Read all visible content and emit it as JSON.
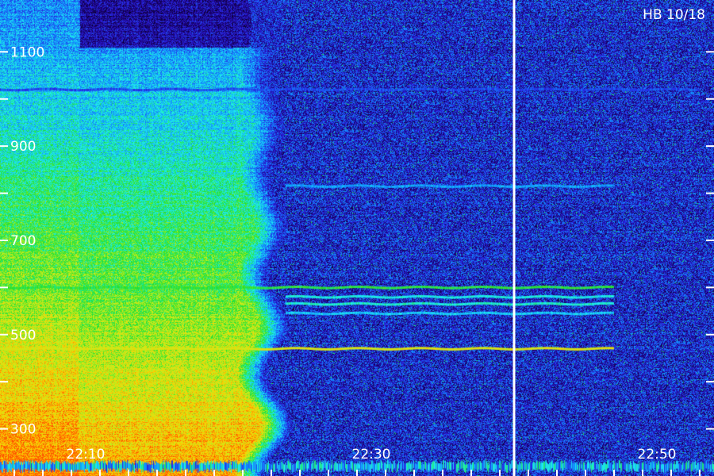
{
  "chart_data": {
    "type": "heatmap",
    "title": "HB 10/18",
    "xlabel": "",
    "ylabel": "",
    "x_tick_labels": [
      "22:10",
      "22:30",
      "22:50"
    ],
    "y_tick_labels": [
      "300",
      "500",
      "700",
      "900",
      "1100"
    ],
    "x_range": [
      "22:04",
      "22:54"
    ],
    "y_range": [
      200,
      1210
    ],
    "y_ticks": [
      300,
      400,
      500,
      600,
      700,
      800,
      900,
      1000,
      1100
    ],
    "colormap": [
      "#000000",
      "#1a0070",
      "#2a20e0",
      "#1090ff",
      "#20f0f0",
      "#20e030",
      "#c0f020",
      "#ffd000",
      "#ff5000"
    ],
    "marker_time": "22:40",
    "broadband_end_time": "22:24",
    "lines": [
      {
        "freq": 1020,
        "intensity": 0.3,
        "start": "22:04",
        "end": "22:53"
      },
      {
        "freq": 815,
        "intensity": 0.4,
        "start": "22:24",
        "end": "22:47"
      },
      {
        "freq": 600,
        "intensity": 0.62,
        "start": "22:04",
        "end": "22:47"
      },
      {
        "freq": 580,
        "intensity": 0.5,
        "start": "22:24",
        "end": "22:47"
      },
      {
        "freq": 565,
        "intensity": 0.52,
        "start": "22:24",
        "end": "22:47"
      },
      {
        "freq": 545,
        "intensity": 0.45,
        "start": "22:24",
        "end": "22:47"
      },
      {
        "freq": 470,
        "intensity": 0.8,
        "start": "22:04",
        "end": "22:47"
      }
    ]
  }
}
